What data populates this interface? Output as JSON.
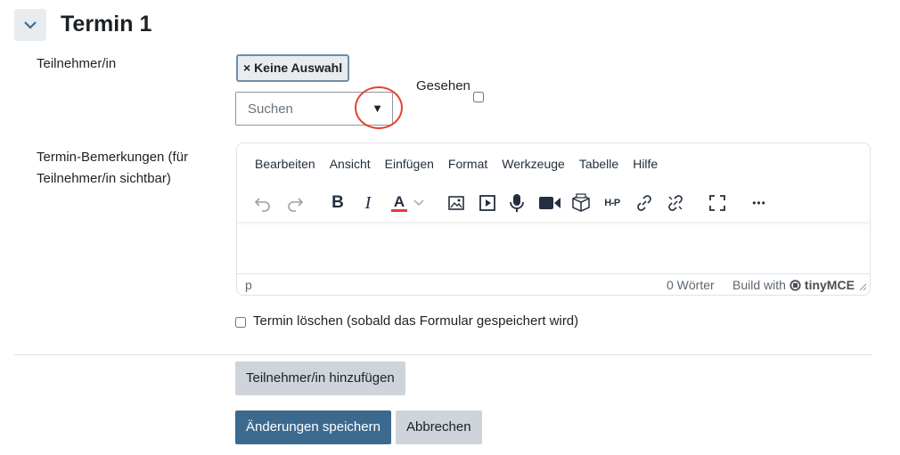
{
  "section": {
    "title": "Termin 1"
  },
  "participant": {
    "label": "Teilnehmer/in",
    "selected_chip": "× Keine Auswahl",
    "search_placeholder": "Suchen",
    "dropdown_arrow": "▼",
    "seen_label": "Gesehen",
    "seen_checked": false
  },
  "remarks": {
    "label_line1": "Termin-Bemerkungen (für",
    "label_line2": "Teilnehmer/in sichtbar)"
  },
  "editor": {
    "menus": [
      "Bearbeiten",
      "Ansicht",
      "Einfügen",
      "Format",
      "Werkzeuge",
      "Tabelle",
      "Hilfe"
    ],
    "toolbar_icons": [
      "undo-icon",
      "redo-icon",
      "bold-icon",
      "italic-icon",
      "text-color-icon",
      "text-color-dropdown-icon",
      "image-icon",
      "media-icon",
      "microphone-icon",
      "video-camera-icon",
      "cube-icon",
      "h5p-icon",
      "link-icon",
      "unlink-icon",
      "fullscreen-icon",
      "more-icon"
    ],
    "bold_glyph": "B",
    "italic_glyph": "I",
    "text_color_glyph": "A",
    "h5p_glyph": "H-P",
    "more_glyph": "•••",
    "status_path": "p",
    "word_count": "0 Wörter",
    "brand_prefix": "Build with",
    "brand_name": "tinyMCE",
    "text_color_accent": "#e03e2d"
  },
  "delete_option": {
    "label": "Termin löschen (sobald das Formular gespeichert wird)",
    "checked": false
  },
  "buttons": {
    "add_participant": "Teilnehmer/in hinzufügen",
    "save": "Änderungen speichern",
    "cancel": "Abbrechen"
  },
  "colors": {
    "primary": "#3c6a8f",
    "chip_border": "#6c8ea8",
    "highlight_circle": "#e0452c"
  }
}
